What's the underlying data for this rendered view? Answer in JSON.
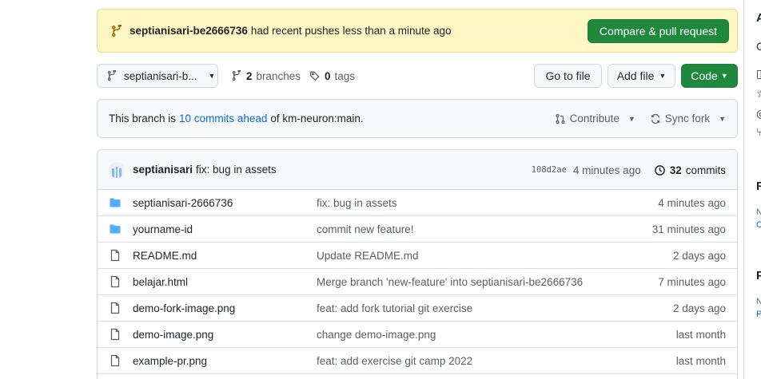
{
  "banner": {
    "branch": "septianisari-be2666736",
    "text": "had recent pushes less than a minute ago",
    "compare_label": "Compare & pull request"
  },
  "toolbar": {
    "branch_select": "septianisari-b...",
    "branches_count": "2",
    "branches_label": "branches",
    "tags_count": "0",
    "tags_label": "tags",
    "goto_label": "Go to file",
    "addfile_label": "Add file",
    "code_label": "Code"
  },
  "ahead": {
    "prefix": "This branch is",
    "link": "10 commits ahead",
    "suffix": "of km-neuron:main.",
    "contribute": "Contribute",
    "sync": "Sync fork"
  },
  "latest_commit": {
    "author": "septianisari",
    "message": "fix: bug in assets",
    "sha": "108d2ae",
    "time": "4 minutes ago",
    "commits_count": "32",
    "commits_label": "commits"
  },
  "files": [
    {
      "type": "folder",
      "name": "septianisari-2666736",
      "message": "fix: bug in assets",
      "time": "4 minutes ago"
    },
    {
      "type": "folder",
      "name": "yourname-id",
      "message": "commit new feature!",
      "time": "31 minutes ago"
    },
    {
      "type": "file",
      "name": "README.md",
      "message": "Update README.md",
      "time": "2 days ago"
    },
    {
      "type": "file",
      "name": "belajar.html",
      "message": "Merge branch 'new-feature' into septianisari-be2666736",
      "time": "7 minutes ago"
    },
    {
      "type": "file",
      "name": "demo-fork-image.png",
      "message": "feat: add fork tutorial git exercise",
      "time": "2 days ago"
    },
    {
      "type": "file",
      "name": "demo-image.png",
      "message": "change demo-image.png",
      "time": "last month"
    },
    {
      "type": "file",
      "name": "example-pr.png",
      "message": "feat: add exercise git camp 2022",
      "time": "last month"
    }
  ],
  "sidebar": {
    "about_initial": "A",
    "gear_initial": "G",
    "releases_initial": "R",
    "releases_sub": "N",
    "releases_link": "C",
    "packages_initial": "P",
    "packages_sub": "N",
    "packages_link": "P"
  },
  "colors": {
    "accent_green": "#1f883d",
    "link_blue": "#0969da",
    "folder_blue": "#54aeff",
    "banner_bg": "#fff8c5"
  }
}
